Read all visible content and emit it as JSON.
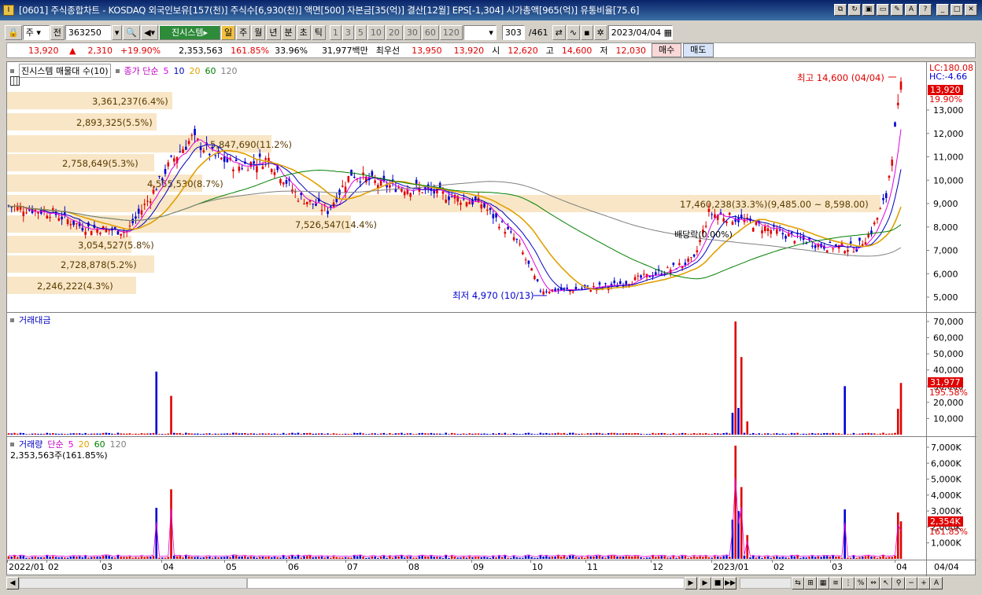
{
  "window": {
    "title": "[0601] 주식종합차트 - KOSDAQ 외국인보유[157(천)] 주식수[6,930(천)] 액면[500] 자본금[35(억)] 결산[12월] EPS[-1,304] 시가총액[965(억)] 유통비율[75.6]",
    "app_icon": "I"
  },
  "toolbar": {
    "type_select": "주",
    "prev_label": "전",
    "code": "363250",
    "name_badge": "진시스템",
    "buttons": [
      "일",
      "주",
      "월",
      "년",
      "분",
      "초",
      "틱"
    ],
    "active": "일",
    "periods": [
      "1",
      "3",
      "5",
      "10",
      "20",
      "30",
      "60",
      "120"
    ],
    "count": "303",
    "total": "/461",
    "date": "2023/04/04"
  },
  "quote": {
    "price": "13,920",
    "updown": "▲",
    "change": "2,310",
    "pct": "+19.90%",
    "volume": "2,353,563",
    "vol_ratio": "161.85%",
    "turnover": "33.96%",
    "amount": "31,977백만",
    "best_label": "최우선",
    "ask": "13,950",
    "bid": "13,920",
    "open_label": "시",
    "open": "12,620",
    "high_label": "고",
    "high": "14,600",
    "low_label": "저",
    "low": "12,030",
    "buy_label": "매수",
    "sell_label": "매도"
  },
  "price_panel": {
    "legend_title": "진시스템 매물대 수(10)",
    "legend_ma": "종가 단순",
    "ma": [
      "5",
      "10",
      "20",
      "60",
      "120"
    ],
    "lc": "LC:180.08",
    "hc": "HC:-4.66",
    "last_price": "13,920",
    "last_pct": "19.90%",
    "yticks": [
      "13,000",
      "12,000",
      "11,000",
      "10,000",
      "9,000",
      "8,000",
      "7,000",
      "6,000",
      "5,000"
    ],
    "ytick_vals": [
      13000,
      12000,
      11000,
      10000,
      9000,
      8000,
      7000,
      6000,
      5000
    ],
    "high_note": "최고 14,600 (04/04)",
    "low_note": "최저 4,970 (10/13)",
    "div_note": "배당락(0.00%)",
    "volume_profile": [
      {
        "label": "3,361,237(6.4%)"
      },
      {
        "label": "2,893,325(5.5%)"
      },
      {
        "label": "5,847,690(11.2%)"
      },
      {
        "label": "2,758,649(5.3%)"
      },
      {
        "label": "4,555,530(8.7%)"
      },
      {
        "label": "17,460,238(33.3%)(9,485.00 ~ 8,598.00)"
      },
      {
        "label": "7,526,547(14.4%)"
      },
      {
        "label": "3,054,527(5.8%)"
      },
      {
        "label": "2,728,878(5.2%)"
      },
      {
        "label": "2,246,222(4.3%)"
      }
    ]
  },
  "amount_panel": {
    "title": "거래대금",
    "yticks": [
      "70,000",
      "60,000",
      "50,000",
      "40,000",
      "30,000",
      "20,000",
      "10,000"
    ],
    "last": "31,977",
    "last_pct": "195.58%"
  },
  "volume_panel": {
    "title": "거래량",
    "legend_ma": "단순",
    "ma": [
      "5",
      "20",
      "60",
      "120"
    ],
    "sub": "2,353,563주(161.85%)",
    "yticks": [
      "7,000K",
      "6,000K",
      "5,000K",
      "4,000K",
      "3,000K",
      "2,000K",
      "1,000K"
    ],
    "last": "2,354K",
    "last_pct": "161.85%"
  },
  "xaxis": {
    "labels": [
      "2022/01",
      "02",
      "03",
      "04",
      "05",
      "06",
      "07",
      "08",
      "09",
      "10",
      "11",
      "12",
      "2023/01",
      "02",
      "03",
      "04"
    ],
    "right_label": "04/04"
  },
  "colors": {
    "up": "#e00000",
    "down": "#0000d0",
    "ma5": "#e000e0",
    "ma10": "#0000c0",
    "ma20": "#e0a000",
    "ma60": "#008000",
    "ma120": "#808080",
    "vp": "#f5deb3"
  }
}
